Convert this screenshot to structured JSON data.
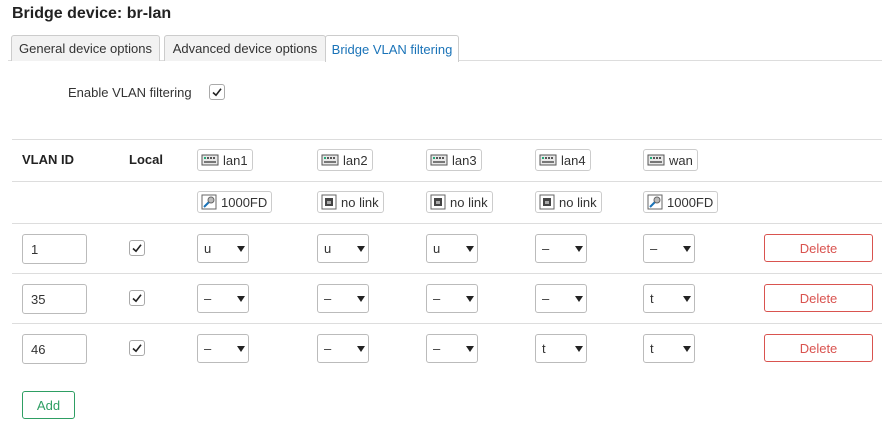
{
  "page_title": "Bridge device: br-lan",
  "tabs": [
    {
      "label": "General device options"
    },
    {
      "label": "Advanced device options"
    },
    {
      "label": "Bridge VLAN filtering"
    }
  ],
  "enable_vlan": {
    "label": "Enable VLAN filtering",
    "checked": true
  },
  "table": {
    "headers": {
      "vlan_id": "VLAN ID",
      "local": "Local"
    },
    "ports": [
      {
        "name": "lan1",
        "status": "1000FD",
        "link": true
      },
      {
        "name": "lan2",
        "status": "no link",
        "link": false
      },
      {
        "name": "lan3",
        "status": "no link",
        "link": false
      },
      {
        "name": "lan4",
        "status": "no link",
        "link": false
      },
      {
        "name": "wan",
        "status": "1000FD",
        "link": true
      }
    ],
    "rows": [
      {
        "vlan_id": "1",
        "local": true,
        "ports": [
          "u",
          "u",
          "u",
          "–",
          "–"
        ],
        "delete_label": "Delete"
      },
      {
        "vlan_id": "35",
        "local": true,
        "ports": [
          "–",
          "–",
          "–",
          "–",
          "t"
        ],
        "delete_label": "Delete"
      },
      {
        "vlan_id": "46",
        "local": true,
        "ports": [
          "–",
          "–",
          "–",
          "t",
          "t"
        ],
        "delete_label": "Delete"
      }
    ]
  },
  "add_label": "Add",
  "colors": {
    "accent": "#1a73b8",
    "delete": "#d9534f",
    "add": "#2e9e63"
  }
}
